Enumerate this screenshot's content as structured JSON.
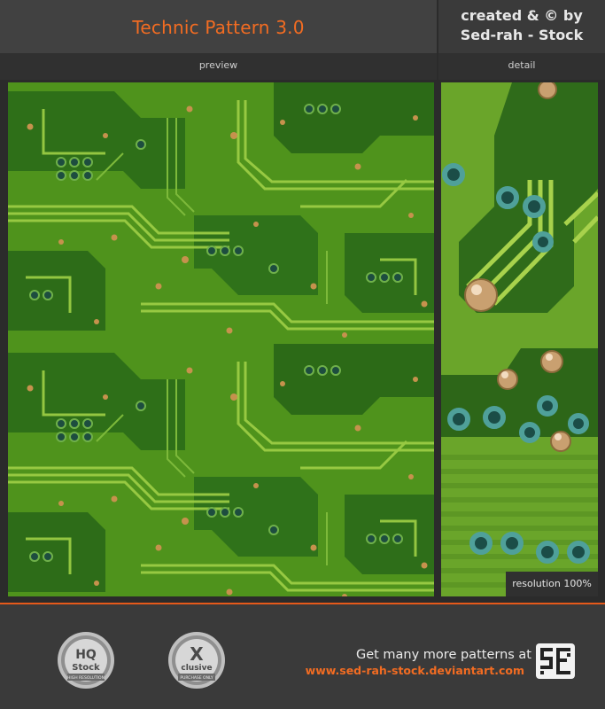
{
  "header": {
    "title": "Technic Pattern 3.0",
    "credit_line1": "created & © by",
    "credit_line2": "Sed-rah - Stock"
  },
  "panels": {
    "preview_label": "preview",
    "detail_label": "detail",
    "resolution_label": "resolution 100%"
  },
  "footer": {
    "cta_text": "Get many more patterns at",
    "url": "www.sed-rah-stock.deviantart.com",
    "badge_hq": {
      "top": "HQ",
      "bottom": "Stock",
      "ring": "HIGH RESOLUTION"
    },
    "badge_x": {
      "top": "X",
      "bottom": "clusive",
      "ring": "PURCHASE ONLY"
    }
  },
  "colors": {
    "accent": "#f26c22",
    "pcb_green": "#6aa52a",
    "pcb_dark": "#2f6b1a",
    "trace": "#9ccd45",
    "copper": "#c6924d"
  }
}
